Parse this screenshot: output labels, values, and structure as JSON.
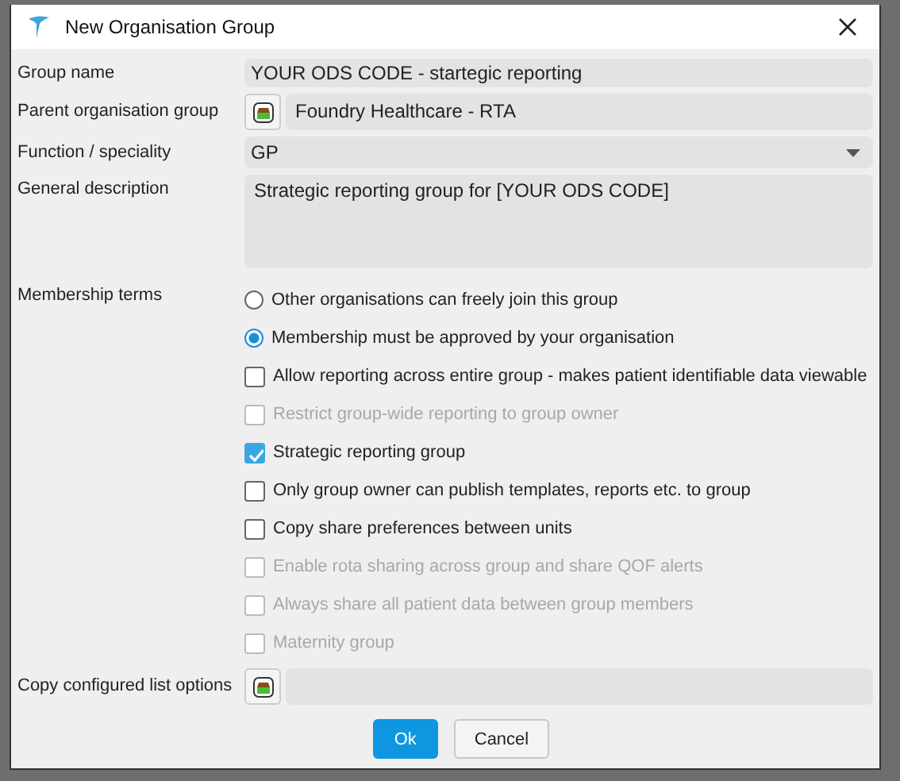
{
  "window": {
    "title": "New Organisation Group"
  },
  "fields": [
    {
      "kind": "text",
      "label": "Group name",
      "value": "YOUR ODS CODE - startegic reporting"
    },
    {
      "kind": "picker",
      "label": "Parent organisation group",
      "value": "Foundry Healthcare - RTA"
    },
    {
      "kind": "dropdown",
      "label": "Function / speciality",
      "value": "GP"
    },
    {
      "kind": "textarea",
      "label": "General description",
      "value": "Strategic reporting group for [YOUR ODS CODE]"
    }
  ],
  "membership": {
    "label": "Membership terms",
    "options": [
      {
        "kind": "radio",
        "label": "Other organisations can freely join this group",
        "selected": false,
        "disabled": false
      },
      {
        "kind": "radio",
        "label": "Membership must be approved by your organisation",
        "selected": true,
        "disabled": false
      },
      {
        "kind": "checkbox",
        "label": "Allow reporting across entire group - makes patient identifiable data viewable",
        "checked": false,
        "disabled": false
      },
      {
        "kind": "checkbox",
        "label": "Restrict group-wide reporting to group owner",
        "checked": false,
        "disabled": true
      },
      {
        "kind": "checkbox",
        "label": "Strategic reporting group",
        "checked": true,
        "disabled": false
      },
      {
        "kind": "checkbox",
        "label": "Only group owner can publish templates, reports etc. to group",
        "checked": false,
        "disabled": false
      },
      {
        "kind": "checkbox",
        "label": "Copy share preferences between units",
        "checked": false,
        "disabled": false
      },
      {
        "kind": "checkbox",
        "label": "Enable rota sharing across group and share QOF alerts",
        "checked": false,
        "disabled": true
      },
      {
        "kind": "checkbox",
        "label": "Always share all patient data between group members",
        "checked": false,
        "disabled": true
      },
      {
        "kind": "checkbox",
        "label": "Maternity group",
        "checked": false,
        "disabled": true
      }
    ]
  },
  "copy_list": {
    "kind": "picker",
    "label": "Copy configured list options"
  },
  "buttons": [
    {
      "label": "Ok",
      "primary": true
    },
    {
      "label": "Cancel",
      "primary": false
    }
  ]
}
